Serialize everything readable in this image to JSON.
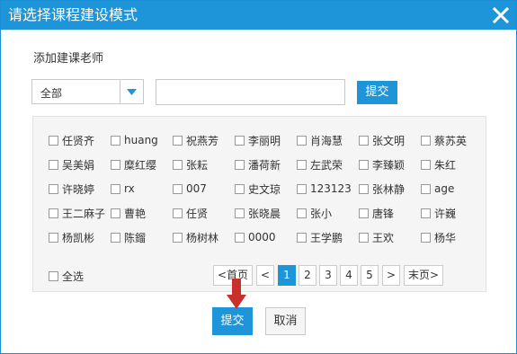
{
  "dialog": {
    "title": "请选择课程建设模式",
    "close_icon": "close-icon",
    "section_label": "添加建课老师",
    "dropdown": {
      "selected": "全部"
    },
    "search": {
      "value": "",
      "placeholder": ""
    },
    "submit_top_label": "提交",
    "teachers": [
      [
        "任贤齐",
        "huang",
        "祝燕芳",
        "李丽明",
        "肖海慧",
        "张文明",
        "蔡苏英"
      ],
      [
        "吴美娟",
        "糜红缨",
        "张耘",
        "潘荷新",
        "左武荣",
        "李臻颖",
        "朱红"
      ],
      [
        "许晓婷",
        "rx",
        "007",
        "史文琼",
        "123123",
        "张林静",
        "age"
      ],
      [
        "王二麻子",
        "曹艳",
        "任贤",
        "张晓晨",
        "张小",
        "唐锋",
        "许巍"
      ],
      [
        "杨凯彬",
        "陈鎦",
        "杨树林",
        "0000",
        "王学鹏",
        "王欢",
        "杨华"
      ]
    ],
    "select_all_label": "全选",
    "pagination": {
      "first": "<首页",
      "prev": "<",
      "pages": [
        "1",
        "2",
        "3",
        "4",
        "5"
      ],
      "current": "1",
      "next": ">",
      "last": "末页>"
    },
    "submit_bottom_label": "提交",
    "cancel_label": "取消",
    "colors": {
      "accent": "#1e95d9",
      "panel_bg": "#f5f5f5",
      "arrow": "#c9302c"
    }
  }
}
